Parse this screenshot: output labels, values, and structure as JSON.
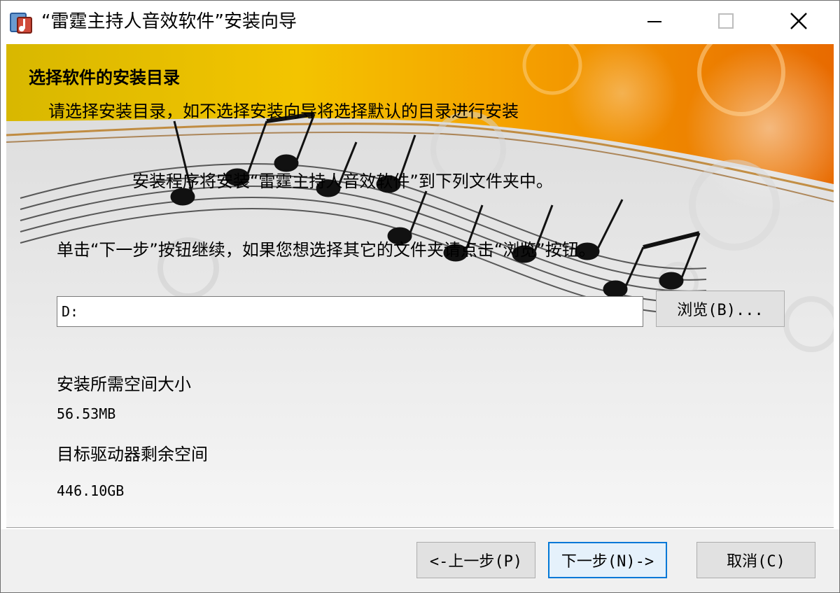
{
  "window": {
    "title": "“雷霆主持人音效软件”安装向导"
  },
  "page": {
    "heading": "选择软件的安装目录",
    "subheading": "请选择安装目录，如不选择安装向导将选择默认的目录进行安装",
    "info_line1": "安装程序将安装“雷霆主持人音效软件”到下列文件夹中。",
    "info_line2": "单击“下一步”按钮继续，如果您想选择其它的文件夹请点击“浏览”按钮。"
  },
  "install_path": {
    "value": "D:"
  },
  "browse_button": {
    "label": "浏览(B)..."
  },
  "space": {
    "required_label": "安装所需空间大小",
    "required_value": "56.53MB",
    "free_label": "目标驱动器剩余空间",
    "free_value": "446.10GB"
  },
  "buttons": {
    "back": "<-上一步(P)",
    "next": "下一步(N)->",
    "cancel": "取消(C)"
  },
  "colors": {
    "accent": "#0078d7",
    "banner_orange": "#f08a00",
    "banner_yellow": "#f3c400"
  },
  "icons": {
    "app": "music-app-icon",
    "minimize": "minimize-icon",
    "maximize": "maximize-icon",
    "close": "close-icon"
  }
}
